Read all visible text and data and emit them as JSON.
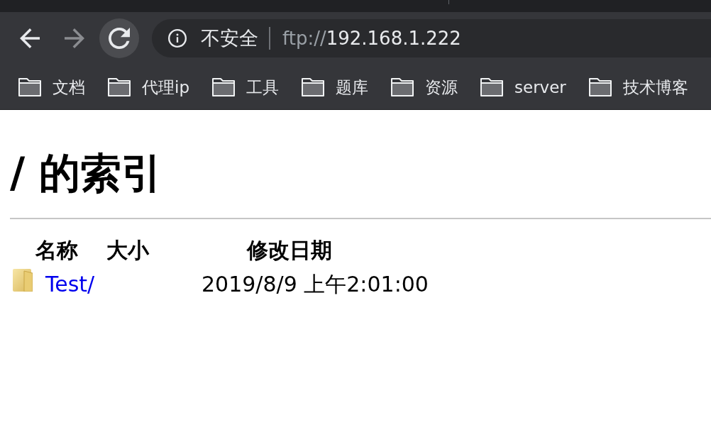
{
  "toolbar": {
    "buttons": [
      {
        "kind": "back",
        "disabled": false,
        "hovered": false
      },
      {
        "kind": "forward",
        "disabled": true,
        "hovered": false
      },
      {
        "kind": "reload",
        "disabled": false,
        "hovered": true
      }
    ]
  },
  "address_bar": {
    "security_label": "不安全",
    "scheme": "ftp://",
    "host": "192.168.1.222"
  },
  "bookmarks": [
    {
      "label": "文档"
    },
    {
      "label": "代理ip"
    },
    {
      "label": "工具"
    },
    {
      "label": "题库"
    },
    {
      "label": "资源"
    },
    {
      "label": "server"
    },
    {
      "label": "技术博客"
    }
  ],
  "page": {
    "heading": "/ 的索引",
    "table": {
      "columns": [
        "名称",
        "大小",
        "修改日期"
      ],
      "rows": [
        {
          "kind": "folder",
          "name": "Test/",
          "modified": "2019/8/9 上午2:01:00"
        }
      ]
    }
  }
}
